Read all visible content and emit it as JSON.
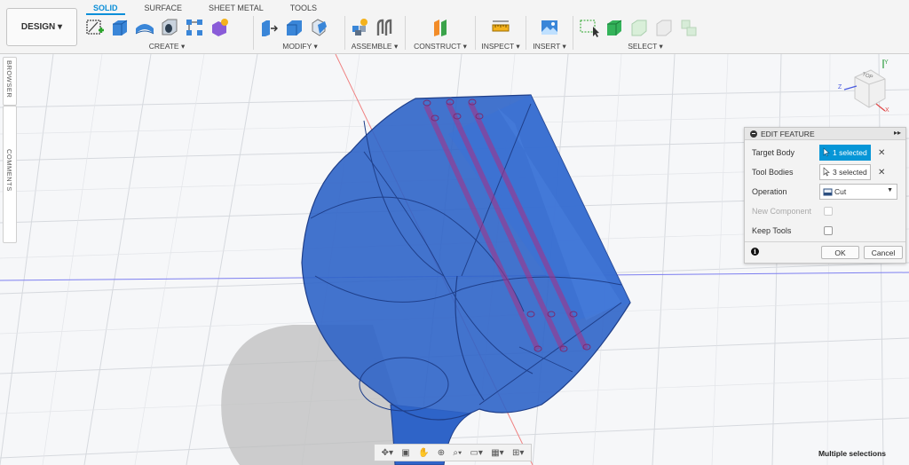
{
  "toolbar": {
    "design_label": "DESIGN ▾",
    "tabs": [
      "SOLID",
      "SURFACE",
      "SHEET METAL",
      "TOOLS"
    ],
    "groups": {
      "create": "CREATE ▾",
      "modify": "MODIFY ▾",
      "assemble": "ASSEMBLE ▾",
      "construct": "CONSTRUCT ▾",
      "inspect": "INSPECT ▾",
      "insert": "INSERT ▾",
      "select": "SELECT ▾"
    }
  },
  "side_tabs": {
    "browser": "BROWSER",
    "comments": "COMMENTS"
  },
  "view_cube": {
    "face_label": "TOP",
    "axes": [
      "Z",
      "Y",
      "X"
    ]
  },
  "panel": {
    "title": "EDIT FEATURE",
    "target_body_label": "Target Body",
    "target_body_value": "1 selected",
    "tool_bodies_label": "Tool Bodies",
    "tool_bodies_value": "3 selected",
    "operation_label": "Operation",
    "operation_value": "Cut",
    "new_component_label": "New Component",
    "keep_tools_label": "Keep Tools",
    "ok_label": "OK",
    "cancel_label": "Cancel"
  },
  "status": {
    "selection_text": "Multiple selections"
  },
  "colors": {
    "accent": "#0696d7",
    "model_fill": "#2f64c8",
    "model_stroke": "#1f3f8a",
    "tool_fill": "#a0338a"
  }
}
